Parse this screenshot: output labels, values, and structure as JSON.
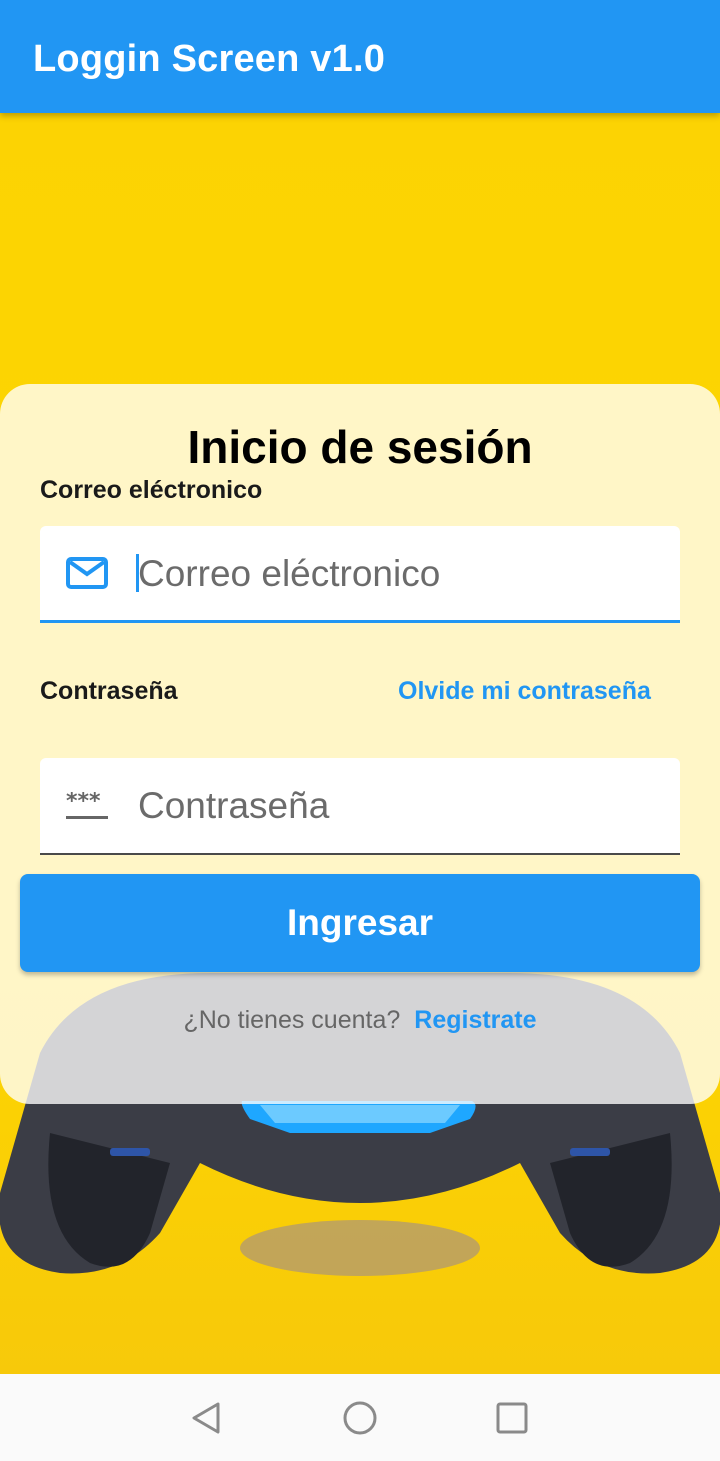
{
  "appbar": {
    "title": "Loggin Screen v1.0"
  },
  "card": {
    "title": "Inicio de sesión",
    "email_label": "Correo eléctronico",
    "email_placeholder": "Correo eléctronico",
    "email_value": "",
    "email_icon": "mail-icon",
    "password_label": "Contraseña",
    "forgot_link": "Olvide mi contraseña",
    "password_placeholder": "Contraseña",
    "password_value": "",
    "password_icon": "password-icon",
    "submit_label": "Ingresar",
    "no_account_text": "¿No tienes cuenta?",
    "register_link": "Registrate"
  },
  "navbar": {
    "back_icon": "back-triangle-icon",
    "home_icon": "home-circle-icon",
    "recents_icon": "recents-square-icon"
  },
  "colors": {
    "primary": "#2196F3",
    "background": "#FDD700",
    "card": "#FFF6CC"
  }
}
